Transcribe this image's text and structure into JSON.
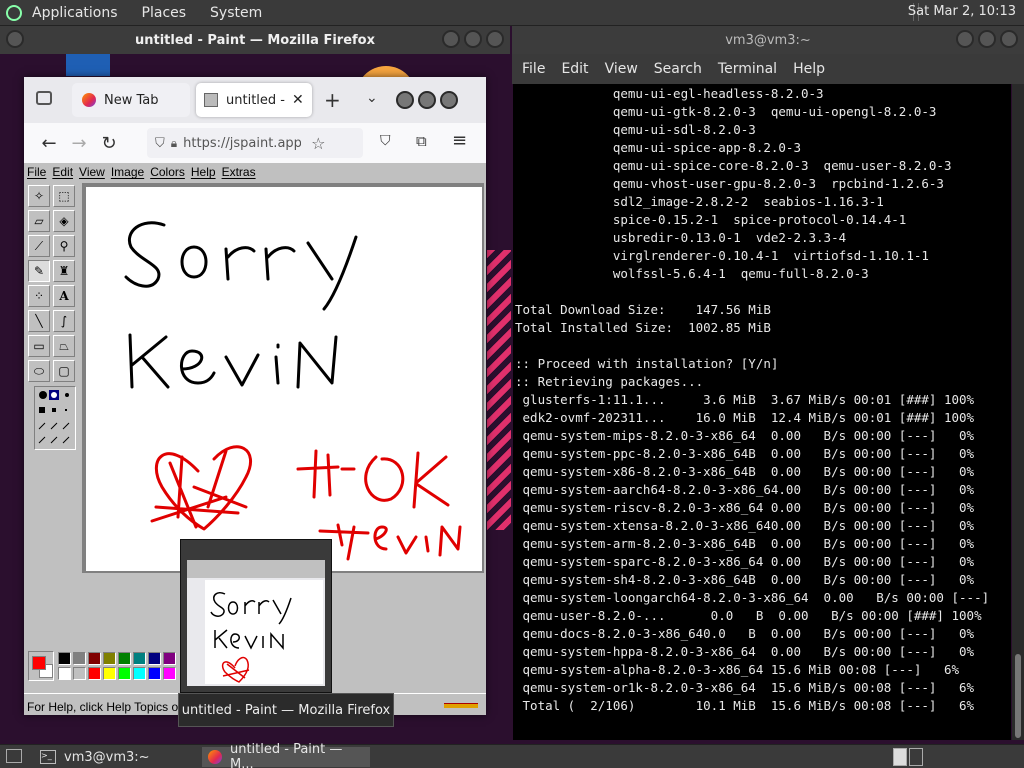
{
  "top_panel": {
    "menus": [
      "Applications",
      "Places",
      "System"
    ],
    "clock": "Sat Mar  2, 10:13"
  },
  "firefox": {
    "window_title": "untitled - Paint — Mozilla Firefox",
    "tabs": [
      {
        "label": "New Tab"
      },
      {
        "label": "untitled - F"
      }
    ],
    "url": "https://jspaint.app/",
    "url_display": "https://jspaint.app/#"
  },
  "paint": {
    "menu": [
      "File",
      "Edit",
      "View",
      "Image",
      "Colors",
      "Help",
      "Extras"
    ],
    "status_text": "For Help, click Help Topics o",
    "palette_colors": [
      "#000000",
      "#808080",
      "#800000",
      "#808000",
      "#008000",
      "#008080",
      "#000080",
      "#800080",
      "#ffffff",
      "#c0c0c0",
      "#ff0000",
      "#ffff00",
      "#00ff00",
      "#00ffff",
      "#0000ff",
      "#ff00ff"
    ],
    "primary_color": "#ff0000",
    "secondary_color": "#ffffff"
  },
  "preview": {
    "tooltip": "untitled - Paint — Mozilla Firefox"
  },
  "terminal": {
    "window_title": "vm3@vm3:~",
    "menus": [
      "File",
      "Edit",
      "View",
      "Search",
      "Terminal",
      "Help"
    ],
    "lines": [
      "             qemu-ui-egl-headless-8.2.0-3",
      "             qemu-ui-gtk-8.2.0-3  qemu-ui-opengl-8.2.0-3",
      "             qemu-ui-sdl-8.2.0-3",
      "             qemu-ui-spice-app-8.2.0-3",
      "             qemu-ui-spice-core-8.2.0-3  qemu-user-8.2.0-3",
      "             qemu-vhost-user-gpu-8.2.0-3  rpcbind-1.2.6-3",
      "             sdl2_image-2.8.2-2  seabios-1.16.3-1",
      "             spice-0.15.2-1  spice-protocol-0.14.4-1",
      "             usbredir-0.13.0-1  vde2-2.3.3-4",
      "             virglrenderer-0.10.4-1  virtiofsd-1.10.1-1",
      "             wolfssl-5.6.4-1  qemu-full-8.2.0-3",
      "",
      "Total Download Size:    147.56 MiB",
      "Total Installed Size:  1002.85 MiB",
      "",
      ":: Proceed with installation? [Y/n]",
      ":: Retrieving packages...",
      " glusterfs-1:11.1...     3.6 MiB  3.67 MiB/s 00:01 [###] 100%",
      " edk2-ovmf-202311...    16.0 MiB  12.4 MiB/s 00:01 [###] 100%",
      " qemu-system-mips-8.2.0-3-x86_64  0.00   B/s 00:00 [---]   0%",
      " qemu-system-ppc-8.2.0-3-x86_64B  0.00   B/s 00:00 [---]   0%",
      " qemu-system-x86-8.2.0-3-x86_64B  0.00   B/s 00:00 [---]   0%",
      " qemu-system-aarch64-8.2.0-3-x86_64.00   B/s 00:00 [---]   0%",
      " qemu-system-riscv-8.2.0-3-x86_64 0.00   B/s 00:00 [---]   0%",
      " qemu-system-xtensa-8.2.0-3-x86_640.00   B/s 00:00 [---]   0%",
      " qemu-system-arm-8.2.0-3-x86_64B  0.00   B/s 00:00 [---]   0%",
      " qemu-system-sparc-8.2.0-3-x86_64 0.00   B/s 00:00 [---]   0%",
      " qemu-system-sh4-8.2.0-3-x86_64B  0.00   B/s 00:00 [---]   0%",
      " qemu-system-loongarch64-8.2.0-3-x86_64  0.00   B/s 00:00 [---]   0%",
      " qemu-user-8.2.0-...      0.0   B  0.00   B/s 00:00 [###] 100%",
      " qemu-docs-8.2.0-3-x86_640.0   B  0.00   B/s 00:00 [---]   0%",
      " qemu-system-hppa-8.2.0-3-x86_64  0.00   B/s 00:00 [---]   0%",
      " qemu-system-alpha-8.2.0-3-x86_64 15.6 MiB 00:08 [---]   6%",
      " qemu-system-or1k-8.2.0-3-x86_64  15.6 MiB/s 00:08 [---]   6%",
      " Total (  2/106)        10.1 MiB  15.6 MiB/s 00:08 [---]   6%"
    ]
  },
  "taskbar": {
    "items": [
      {
        "label": "vm3@vm3:~"
      },
      {
        "label": "untitled - Paint — M..."
      }
    ]
  }
}
